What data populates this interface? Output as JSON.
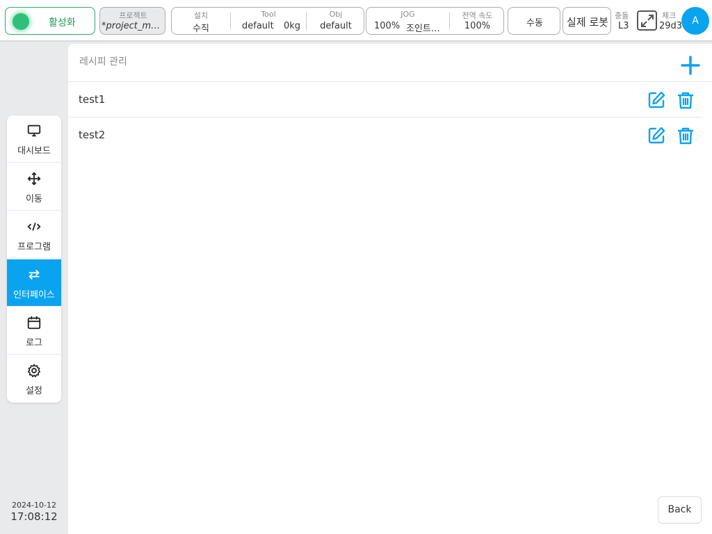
{
  "header": {
    "activation": {
      "label": "활성화",
      "color": "#2ec07a"
    },
    "project": {
      "caption": "프로젝트",
      "value": "*project_mo…"
    },
    "install": {
      "caption": "설치",
      "value": "수직",
      "tool_caption": "Tool",
      "tool_value": "default",
      "tool_load": "0kg",
      "obj_caption": "Obj",
      "obj_value": "default"
    },
    "jog": {
      "caption": "JOG",
      "percent": "100%",
      "mode": "조인트…",
      "speed_caption": "전역 속도",
      "speed_value": "100%"
    },
    "manual_label": "수동",
    "real_robot_label": "실제 로봇",
    "collision": {
      "caption": "충돌",
      "value": "L3"
    },
    "check": {
      "caption": "체크",
      "value": "29d3"
    },
    "avatar_initial": "A",
    "accent_color": "#0aa3f0"
  },
  "sidebar": {
    "items": [
      {
        "label": "대시보드",
        "icon": "monitor-icon",
        "active": false
      },
      {
        "label": "이동",
        "icon": "move-icon",
        "active": false
      },
      {
        "label": "프로그램",
        "icon": "code-icon",
        "active": false
      },
      {
        "label": "인터페이스",
        "icon": "swap-icon",
        "active": true
      },
      {
        "label": "로그",
        "icon": "calendar-icon",
        "active": false
      },
      {
        "label": "설정",
        "icon": "gear-icon",
        "active": false
      }
    ],
    "date": "2024-10-12",
    "time": "17:08:12"
  },
  "main": {
    "title": "레시피 관리",
    "recipes": [
      {
        "name": "test1"
      },
      {
        "name": "test2"
      }
    ],
    "back_label": "Back"
  }
}
